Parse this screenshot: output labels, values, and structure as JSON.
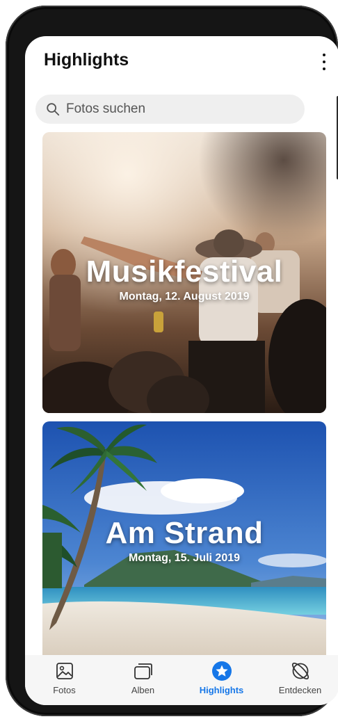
{
  "header": {
    "title": "Highlights",
    "more_icon": "more-vertical-icon"
  },
  "search": {
    "placeholder": "Fotos suchen",
    "icon": "search-icon"
  },
  "highlights": [
    {
      "title": "Musikfestival",
      "date": "Montag, 12. August 2019",
      "image": "concert-crowd"
    },
    {
      "title": "Am Strand",
      "date": "Montag, 15. Juli 2019",
      "image": "tropical-beach"
    }
  ],
  "nav": {
    "items": [
      {
        "label": "Fotos",
        "icon": "image-icon",
        "active": false
      },
      {
        "label": "Alben",
        "icon": "albums-icon",
        "active": false
      },
      {
        "label": "Highlights",
        "icon": "star-icon",
        "active": true
      },
      {
        "label": "Entdecken",
        "icon": "discover-icon",
        "active": false
      }
    ]
  },
  "colors": {
    "accent": "#1677e8",
    "background": "#ffffff",
    "search_bg": "#efefef",
    "nav_bg": "#f6f6f6"
  }
}
